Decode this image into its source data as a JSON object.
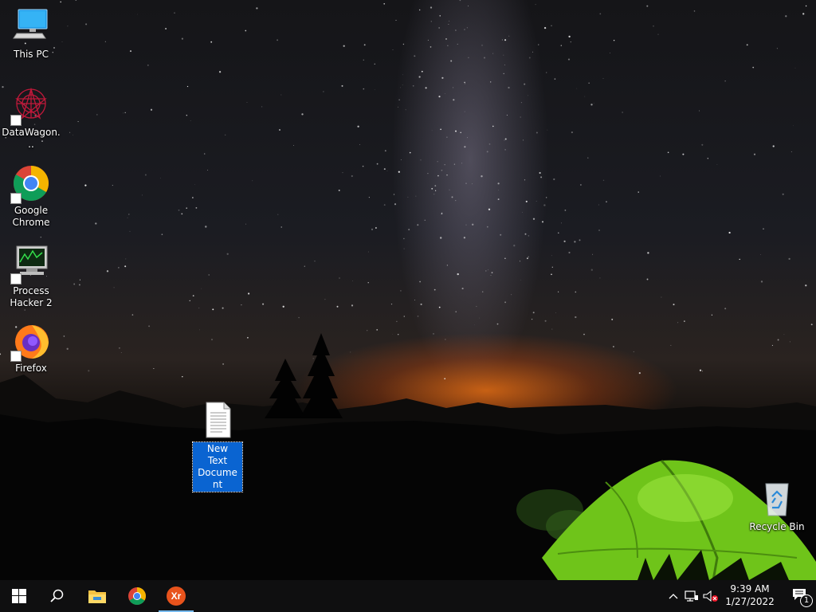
{
  "desktop": {
    "icons": [
      {
        "label": "This PC"
      },
      {
        "label": "DataWagon..."
      },
      {
        "label": "Google Chrome"
      },
      {
        "label": "Process Hacker 2"
      },
      {
        "label": "Firefox"
      },
      {
        "label": "New Text Document",
        "selected": true
      },
      {
        "label": "Recycle Bin"
      }
    ]
  },
  "taskbar": {
    "pinned": [
      "windows-start",
      "search",
      "file-explorer",
      "google-chrome",
      "xr-app"
    ],
    "active_app": "xr-app",
    "xr_badge": "Xr"
  },
  "tray": {
    "time": "9:39 AM",
    "date": "1/27/2022",
    "notification_count": "1",
    "icons": [
      "chevron-up-icon",
      "network-icon",
      "volume-muted-icon",
      "action-center-icon"
    ]
  },
  "colors": {
    "selection": "#0a64d1",
    "taskbar": "#0f0f10",
    "active_indicator": "#76b9ed",
    "tent_green": "#7fd41c"
  }
}
